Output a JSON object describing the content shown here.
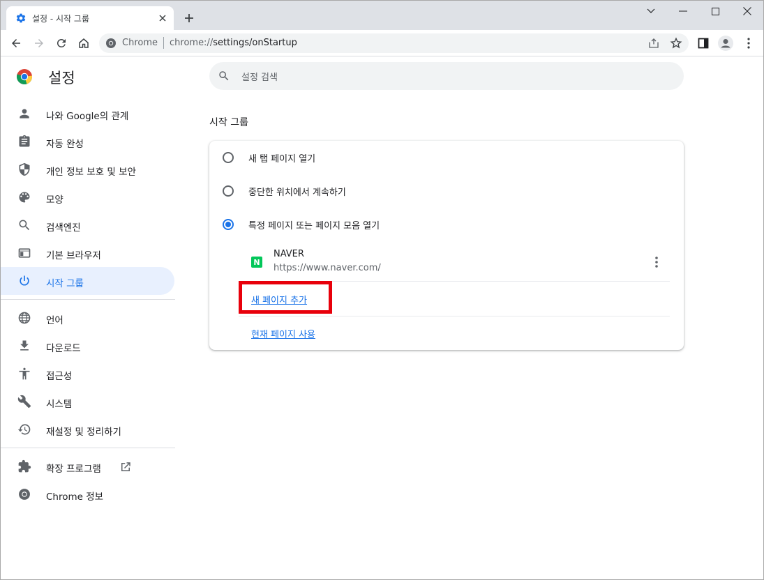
{
  "browser": {
    "tab_title": "설정 - 시작 그룹",
    "omnibox_scheme": "Chrome",
    "omnibox_url_host": "chrome://",
    "omnibox_url_path": "settings/onStartup"
  },
  "settings": {
    "title": "설정",
    "search_placeholder": "설정 검색",
    "nav": [
      {
        "label": "나와 Google의 관계",
        "icon": "person-icon"
      },
      {
        "label": "자동 완성",
        "icon": "clipboard-icon"
      },
      {
        "label": "개인 정보 보호 및 보안",
        "icon": "shield-icon"
      },
      {
        "label": "모양",
        "icon": "palette-icon"
      },
      {
        "label": "검색엔진",
        "icon": "search-icon"
      },
      {
        "label": "기본 브라우저",
        "icon": "browser-window-icon"
      },
      {
        "label": "시작 그룹",
        "icon": "power-icon",
        "active": true
      },
      {
        "label": "언어",
        "icon": "globe-icon"
      },
      {
        "label": "다운로드",
        "icon": "download-icon"
      },
      {
        "label": "접근성",
        "icon": "accessibility-icon"
      },
      {
        "label": "시스템",
        "icon": "wrench-icon"
      },
      {
        "label": "재설정 및 정리하기",
        "icon": "history-icon"
      },
      {
        "label": "확장 프로그램",
        "icon": "puzzle-icon"
      },
      {
        "label": "Chrome 정보",
        "icon": "chrome-icon"
      }
    ],
    "section_title": "시작 그룹",
    "options": [
      {
        "label": "새 탭 페이지 열기",
        "checked": false
      },
      {
        "label": "중단한 위치에서 계속하기",
        "checked": false
      },
      {
        "label": "특정 페이지 또는 페이지 모음 열기",
        "checked": true
      }
    ],
    "pages": [
      {
        "name": "NAVER",
        "url": "https://www.naver.com/",
        "favicon_letter": "N"
      }
    ],
    "add_page_link": "새 페이지 추가",
    "use_current_link": "현재 페이지 사용"
  },
  "colors": {
    "accent": "#1a73e8",
    "highlight": "#e8000b",
    "naver_green": "#03c75a"
  }
}
